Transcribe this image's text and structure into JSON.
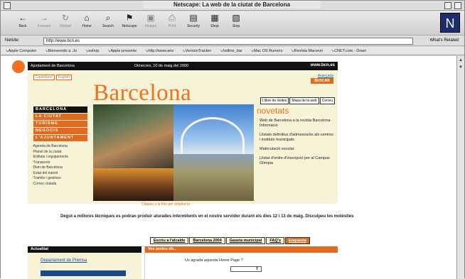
{
  "window": {
    "title": "Netscape: La web de la ciutat de Barcelona"
  },
  "toolbar": {
    "buttons": [
      {
        "label": "Back"
      },
      {
        "label": "Forward"
      },
      {
        "label": "Reload"
      },
      {
        "label": "Home"
      },
      {
        "label": "Search"
      },
      {
        "label": "Netscape"
      },
      {
        "label": "Images"
      },
      {
        "label": "Print"
      },
      {
        "label": "Security"
      },
      {
        "label": "Shop"
      },
      {
        "label": "Stop"
      }
    ]
  },
  "location": {
    "label": "Netsite:",
    "url": "http://www.bcn.es",
    "related": "What's Related"
  },
  "bookmarks": [
    "Apple Computer",
    "Bienvenido a .Jo",
    "eshop",
    "Apple presents",
    "http://www.artv",
    "VersionTracker",
    "hotline_bar",
    "Mac OS Rumors",
    "Revista Macwori",
    "CNET.com - Down"
  ],
  "page": {
    "header_left": "Ajuntament de Barcelona",
    "header_date": "Dimecres, 10 de maig del 2000",
    "header_url": "www.bcn.es",
    "langs": [
      "Castellano",
      "English"
    ],
    "title": "Barcelona",
    "search_advanced": "Avançada",
    "search_button": "BUSCAR",
    "top_links": [
      "Llibre de visites",
      "Mapa de la web",
      "Correu"
    ],
    "menu": [
      {
        "label": "BARCELONA",
        "style": "dark"
      },
      {
        "label": "LA CIUTAT",
        "style": "orange"
      },
      {
        "label": "TURISME",
        "style": "orange"
      },
      {
        "label": "NEGOCIS",
        "style": "orange"
      },
      {
        "label": "L'AJUNTAMENT",
        "style": "orange"
      }
    ],
    "side_links": [
      "Agenda de Barcelona",
      "Planol de la ciutat",
      "Entitats i equipaments",
      "Transports",
      "Diari de Barcelona",
      "Estat del transit",
      "Tramits i gestions",
      "Correu ciutada"
    ],
    "photo_caption": "Cliqueu a la foto per ampliar-la",
    "novetats": {
      "title": "novetats",
      "items": [
        "Web de Barcelona a la revista Barcelona Informació",
        "Llistats definitius d'admesos/es als centres i instituts municipals",
        "Matriculació escolar",
        "Llistat d'ordre d'inscripció per al Campus Olímpia"
      ]
    },
    "notice": "Degut a millores tècniques es podran produir aturades intermitents en el nostre servidor durant els dies 12 i 13 de maig. Disculpeu les molèsties",
    "tabs": [
      "Escriu a l'alcalde",
      "Barcelona 2004",
      "Gaseta municipal",
      "FAQ's",
      "Enquesta"
    ],
    "actualitat": {
      "title": "Actualitat",
      "link": "Departament de Premsa"
    },
    "podeu": {
      "title": "Vos podeu dir...",
      "question": "Us agrada aquesta Home Page ?",
      "select_value": "⇕"
    }
  },
  "colors": {
    "accent": "#f07020",
    "header_bg": "#111111",
    "page_bg": "#f7f3d6"
  }
}
